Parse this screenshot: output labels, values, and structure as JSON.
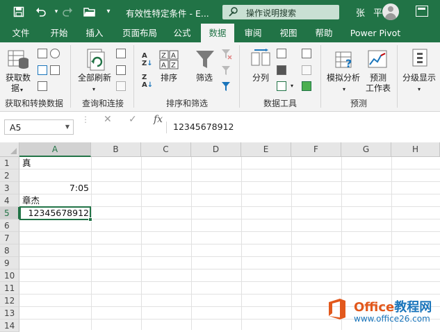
{
  "titlebar": {
    "doc_title": "有效性特定条件 - E...",
    "search_placeholder": "操作说明搜索",
    "user_name": "张 平",
    "accent_color": "#217346"
  },
  "tabs": [
    "文件",
    "开始",
    "插入",
    "页面布局",
    "公式",
    "数据",
    "审阅",
    "视图",
    "帮助",
    "Power Pivot"
  ],
  "active_tab": "数据",
  "ribbon": {
    "get_data_label_line1": "获取数",
    "get_data_label_line2": "据",
    "group_get_transform": "获取和转换数据",
    "refresh_all_label": "全部刷新",
    "group_queries": "查询和连接",
    "sort_label": "排序",
    "filter_label": "筛选",
    "group_sort_filter": "排序和筛选",
    "split_label": "分列",
    "group_data_tools": "数据工具",
    "what_if_label": "模拟分析",
    "forecast_label_line1": "预测",
    "forecast_label_line2": "工作表",
    "group_forecast": "预测",
    "outline_label": "分级显示"
  },
  "formula_bar": {
    "name_box": "A5",
    "formula": "12345678912"
  },
  "grid": {
    "columns": [
      "A",
      "B",
      "C",
      "D",
      "E",
      "F",
      "G",
      "H"
    ],
    "rows": [
      "1",
      "2",
      "3",
      "4",
      "5",
      "6",
      "7",
      "8",
      "9",
      "10",
      "11",
      "12",
      "13",
      "14"
    ],
    "cells": {
      "A1": "真",
      "A3": "7:05",
      "A4": "章杰",
      "A5": "12345678912"
    },
    "selected_cell": "A5"
  },
  "watermark": {
    "title_a": "Office",
    "title_b": "教程网",
    "url": "www.office26.com"
  }
}
